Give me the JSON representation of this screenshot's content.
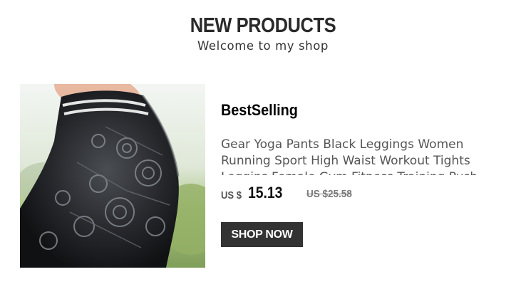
{
  "header": {
    "title": "NEW PRODUCTS",
    "subtitle": "Welcome to my shop"
  },
  "product": {
    "image_icon": "leggings-product-photo",
    "badge": "BestSelling",
    "description": "Gear Yoga Pants Black Leggings Women Running Sport High Waist Workout Tights Leggins Female Gym Fitness Training Push",
    "currency": "US $",
    "price": "15.13",
    "old_price": "US $25.58",
    "button_label": "SHOP NOW"
  },
  "colors": {
    "heading": "#2a2a2a",
    "button_bg": "#333333",
    "button_text": "#ffffff",
    "old_price": "#7a7a7a"
  }
}
